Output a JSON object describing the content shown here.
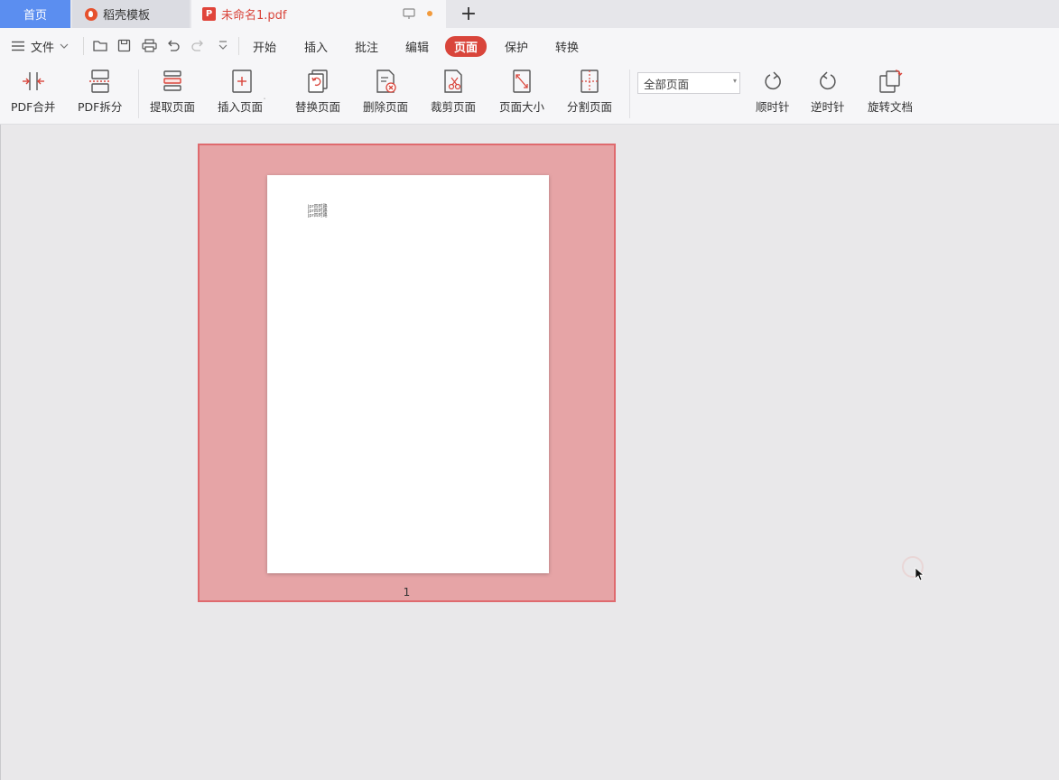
{
  "tabs": {
    "home": "首页",
    "template": "稻壳模板",
    "document": "未命名1.pdf",
    "new_tab": "+"
  },
  "menu": {
    "file": "文件",
    "items": [
      "开始",
      "插入",
      "批注",
      "编辑",
      "页面",
      "保护",
      "转换"
    ],
    "active": "页面"
  },
  "ribbon": {
    "merge": "PDF合并",
    "split": "PDF拆分",
    "extract": "提取页面",
    "insert": "插入页面",
    "replace": "替换页面",
    "delete": "删除页面",
    "crop": "裁剪页面",
    "size": "页面大小",
    "divide": "分割页面",
    "page_range": "全部页面",
    "clockwise": "顺时针",
    "counterclockwise": "逆时针",
    "rotate_doc": "旋转文档"
  },
  "page": {
    "lines": [
      "jpr四时路",
      "jpr四时路",
      "jpr四时路"
    ],
    "number": "1"
  },
  "colors": {
    "accent": "#d9453b",
    "home_tab": "#5b8ef0",
    "selection_fill": "#e6a4a6",
    "selection_border": "#df6a6e"
  }
}
